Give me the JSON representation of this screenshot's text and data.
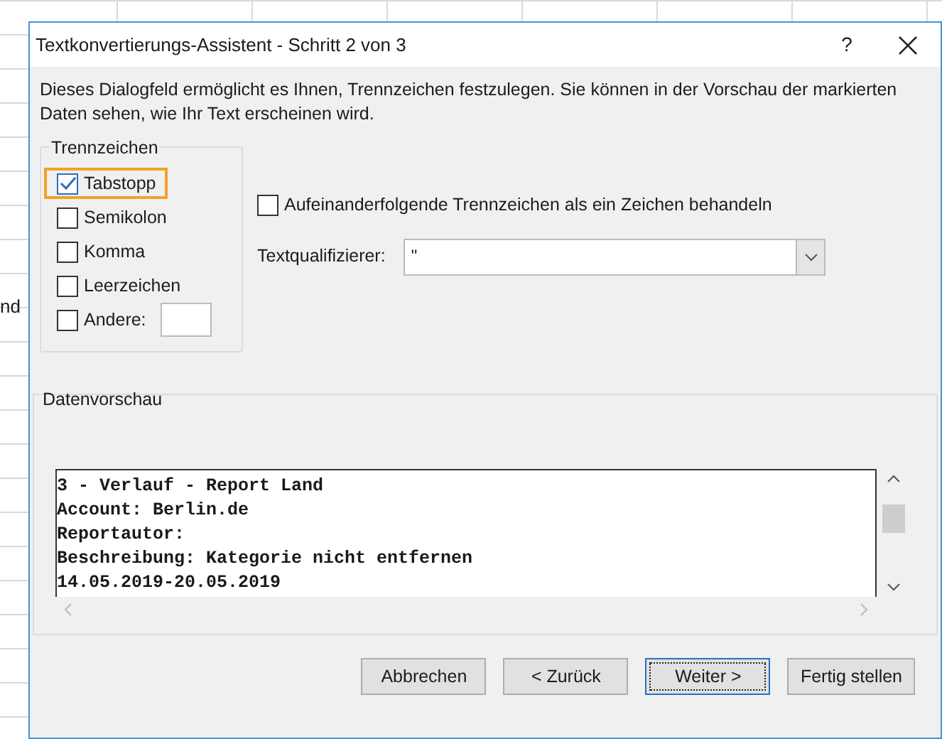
{
  "background": {
    "cell_text": "nd"
  },
  "window": {
    "title": "Textkonvertierungs-Assistent - Schritt 2 von 3",
    "help": "?"
  },
  "description": "Dieses Dialogfeld ermöglicht es Ihnen, Trennzeichen festzulegen. Sie können in der Vorschau der markierten Daten sehen, wie Ihr Text erscheinen wird.",
  "delimiters": {
    "title": "Trennzeichen",
    "items": [
      {
        "label": "Tabstopp",
        "checked": true,
        "highlighted": true,
        "kind": "plain"
      },
      {
        "label": "Semikolon",
        "checked": false,
        "highlighted": false,
        "kind": "plain"
      },
      {
        "label": "Komma",
        "checked": false,
        "highlighted": false,
        "kind": "plain"
      },
      {
        "label": "Leerzeichen",
        "checked": false,
        "highlighted": false,
        "kind": "plain"
      },
      {
        "label": "Andere:",
        "checked": false,
        "highlighted": false,
        "kind": "other"
      }
    ]
  },
  "consecutive": {
    "label": "Aufeinanderfolgende Trennzeichen als ein Zeichen behandeln",
    "checked": false
  },
  "text_qualifier": {
    "label": "Textqualifizierer:",
    "value": "\""
  },
  "preview": {
    "title": "Datenvorschau",
    "lines": [
      "3 - Verlauf - Report Land",
      "Account: Berlin.de",
      "Reportautor:",
      "Beschreibung: Kategorie nicht entfernen",
      "14.05.2019-20.05.2019"
    ]
  },
  "buttons": [
    {
      "label": "Abbrechen",
      "default": false
    },
    {
      "label": "< Zurück",
      "default": false
    },
    {
      "label": "Weiter >",
      "default": true
    },
    {
      "label": "Fertig stellen",
      "default": false
    }
  ]
}
